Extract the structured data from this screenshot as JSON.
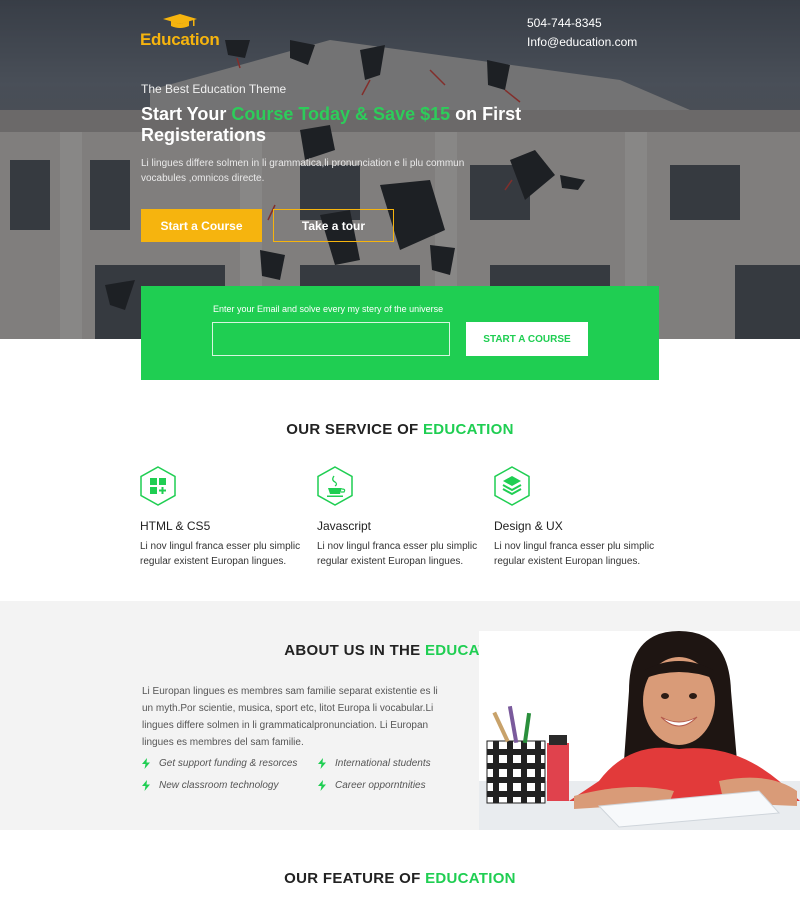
{
  "brand": {
    "name": "Education"
  },
  "contact": {
    "phone": "504-744-8345",
    "email": "Info@education.com"
  },
  "hero": {
    "tagline": "The Best Education Theme",
    "headline_part1": "Start Your ",
    "headline_highlight": "Course Today & Save $15",
    "headline_part2": " on First Registerations",
    "lead": "Li lingues differe solmen in li grammatica,li pronunciation e li plu commun vocabules ,omnicos directe.",
    "primary_button": "Start a Course",
    "secondary_button": "Take a tour"
  },
  "subscribe": {
    "label": "Enter your Email and solve every my stery of the universe",
    "email_value": "",
    "button": "START A COURSE"
  },
  "services": {
    "title": "OUR SERVICE OF ",
    "title_highlight": "EDUCATION",
    "items": [
      {
        "name": "HTML & CS5",
        "description": "Li nov lingul franca esser plu simplic regular existent Europan lingues.",
        "icon": "grid-plus-icon"
      },
      {
        "name": "Javascript",
        "description": "Li nov lingul franca esser plu simplic regular existent Europan lingues.",
        "icon": "java-cup-icon"
      },
      {
        "name": "Design & UX",
        "description": "Li nov lingul franca esser plu simplic regular existent Europan lingues.",
        "icon": "layers-icon"
      }
    ]
  },
  "about": {
    "title": "ABOUT US IN THE ",
    "title_highlight": "EDUCATION",
    "text": "Li Europan lingues es membres sam familie separat existentie es li un myth.Por scientie, musica, sport etc, litot Europa li vocabular.Li lingues differe solmen in li grammaticalpronunciation. Li Europan lingues es membres del sam familie.",
    "features": [
      "Get support funding & resorces",
      "International students",
      "New classroom technology",
      "Career opporntnities"
    ]
  },
  "features_section": {
    "title": "OUR FEATURE OF ",
    "title_highlight": "EDUCATION"
  },
  "colors": {
    "accent_green": "#1fce52",
    "accent_yellow": "#f6b40e"
  }
}
